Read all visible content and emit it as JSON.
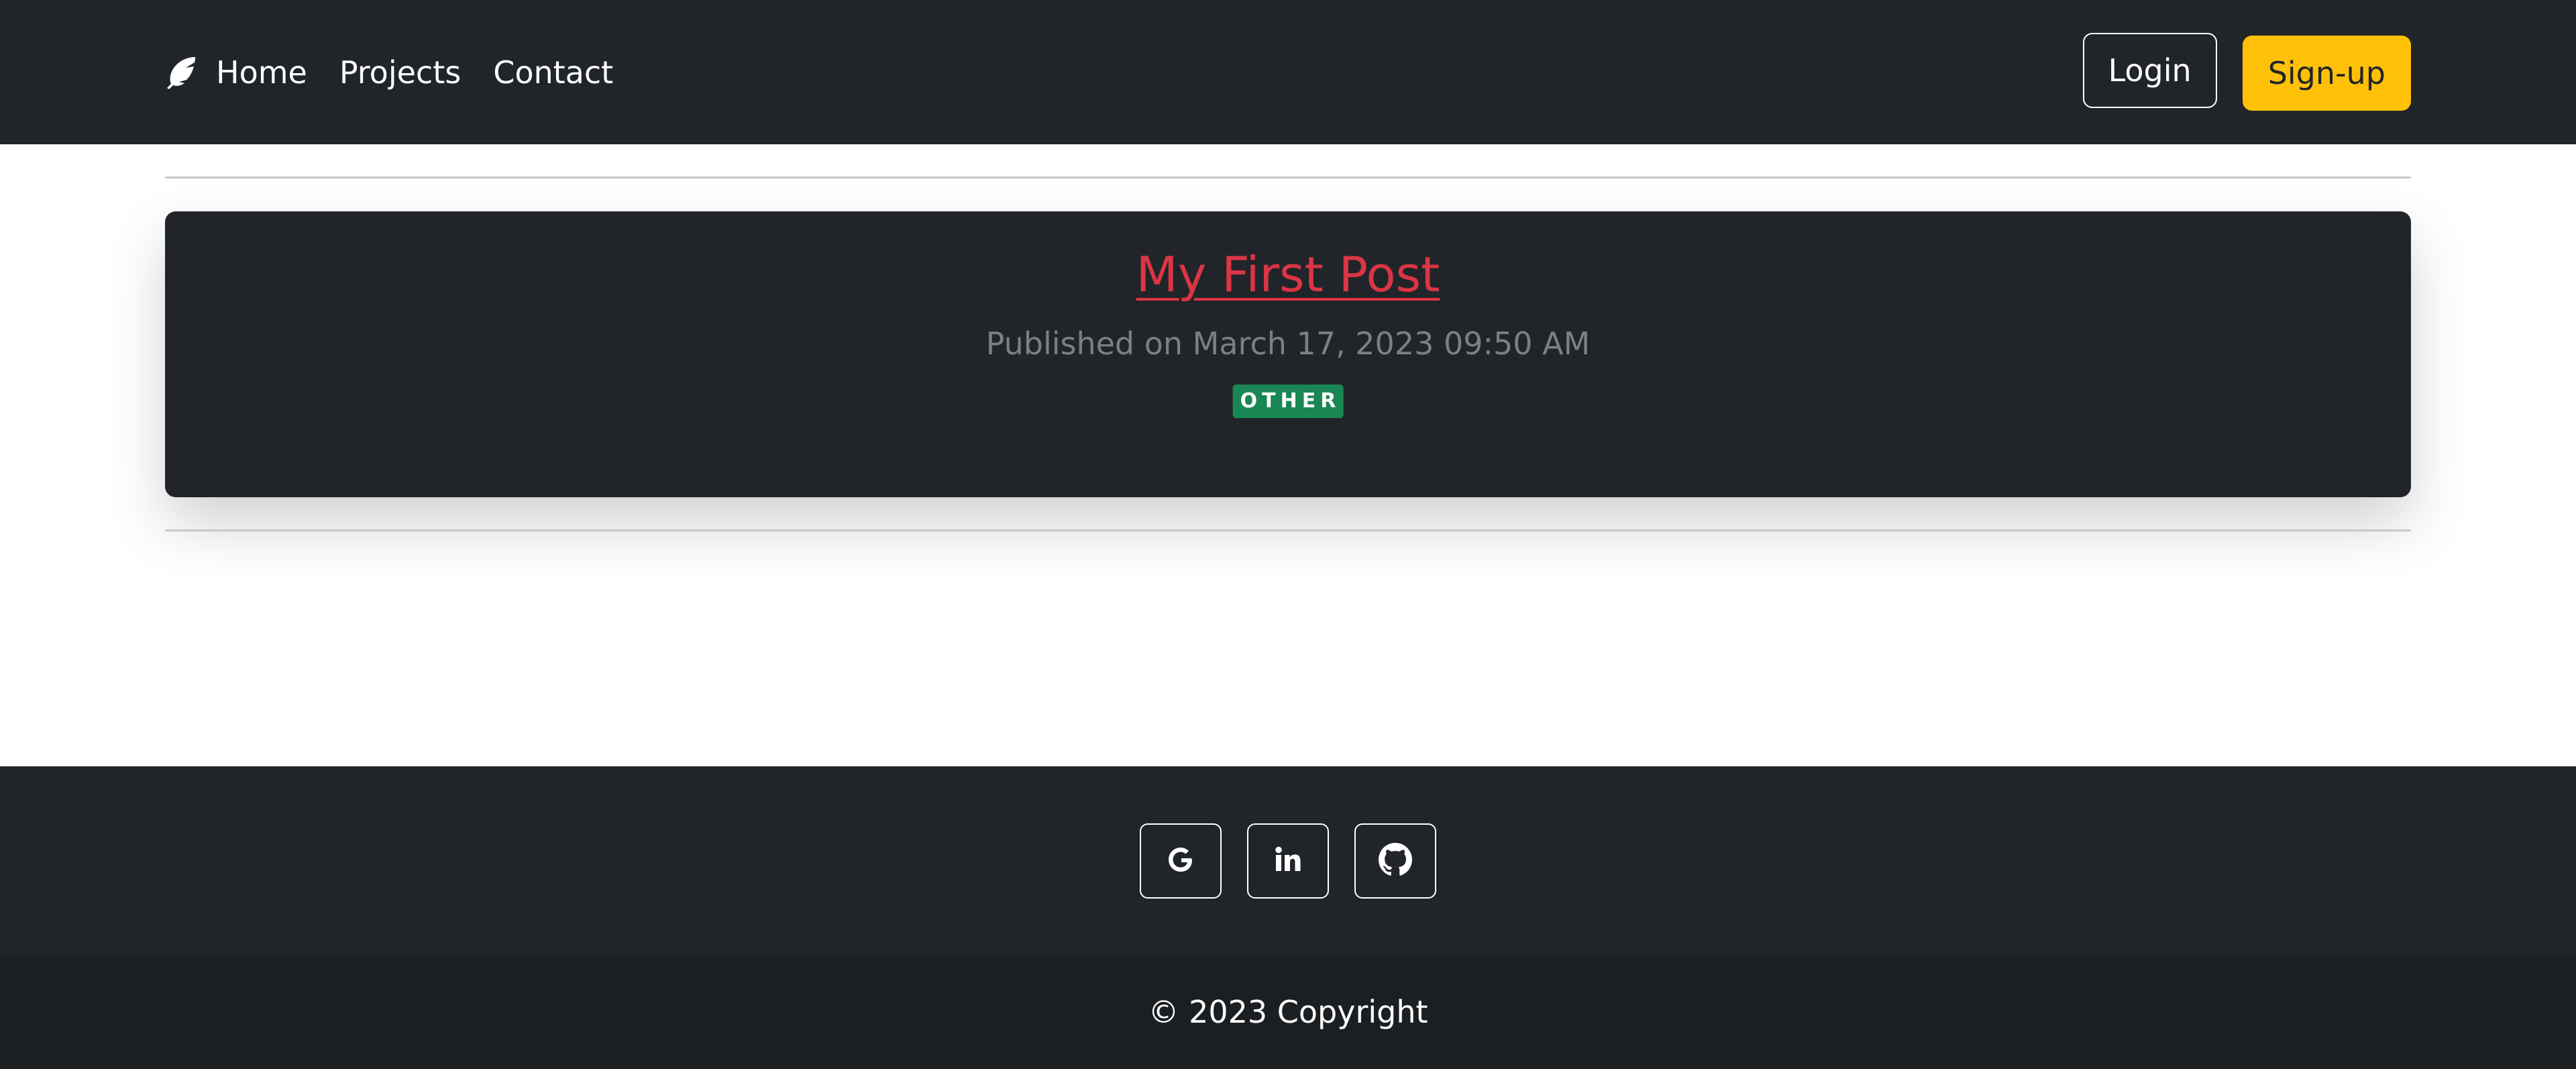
{
  "navbar": {
    "brand_icon": "feather-icon",
    "links": [
      {
        "label": "Home"
      },
      {
        "label": "Projects"
      },
      {
        "label": "Contact"
      }
    ],
    "login_label": "Login",
    "signup_label": "Sign-up"
  },
  "post": {
    "title": "My First Post",
    "published": "Published on March 17, 2023 09:50 AM",
    "tag": "OTHER"
  },
  "footer": {
    "social_icons": [
      "google-icon",
      "linkedin-icon",
      "github-icon"
    ],
    "copyright": "© 2023 Copyright"
  },
  "colors": {
    "navbar_bg": "#212529",
    "accent_yellow": "#ffc107",
    "title_red": "#dc3545",
    "badge_green": "#198754"
  }
}
